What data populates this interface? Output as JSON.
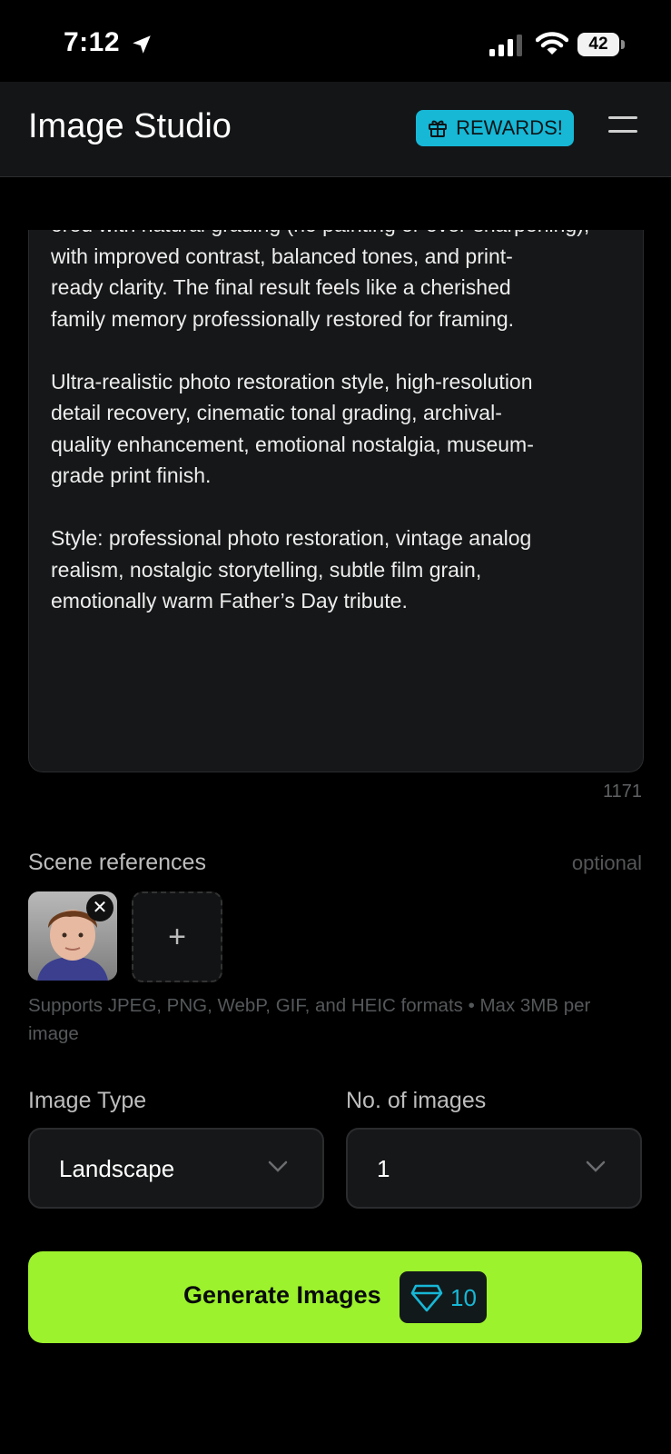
{
  "status_bar": {
    "time": "7:12",
    "battery": "42",
    "location_icon": "location-arrow-icon",
    "signal_icon": "cellular-signal-icon",
    "wifi_icon": "wifi-icon"
  },
  "header": {
    "title": "Image Studio",
    "rewards_label": "REWARDS!",
    "rewards_icon": "gift-icon",
    "menu_icon": "hamburger-menu-icon"
  },
  "prompt": {
    "text": "ored with natural grading (no painting or over-sharpening),\nwith improved contrast, balanced tones, and print-\nready clarity. The final result feels like a cherished\nfamily memory professionally restored for framing.\n\nUltra-realistic photo restoration style, high-resolution\ndetail recovery, cinematic tonal grading, archival-\nquality enhancement, emotional nostalgia, museum-\ngrade print finish.\n\nStyle: professional photo restoration, vintage analog\nrealism, nostalgic storytelling, subtle film grain,\nemotionally warm Father’s Day tribute.",
    "char_count": "1171"
  },
  "scene_references": {
    "label": "Scene references",
    "optional": "optional",
    "add_symbol": "+",
    "remove_symbol": "✕",
    "supports": "Supports JPEG, PNG, WebP, GIF, and HEIC formats • Max 3MB per image"
  },
  "image_type": {
    "label": "Image Type",
    "value": "Landscape"
  },
  "num_images": {
    "label": "No. of images",
    "value": "1"
  },
  "generate": {
    "label": "Generate Images",
    "cost": "10",
    "cost_icon": "gem-icon"
  },
  "colors": {
    "accent_cyan": "#17b7d6",
    "generate_green": "#9cf22d",
    "background": "#000000"
  }
}
